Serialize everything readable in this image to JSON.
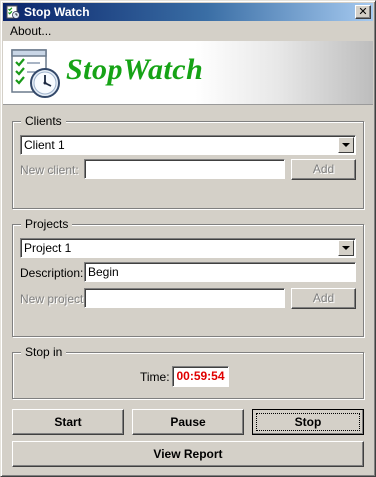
{
  "window": {
    "title": "Stop Watch",
    "close_glyph": "✕"
  },
  "menu": {
    "about": "About..."
  },
  "banner": {
    "brand": "StopWatch",
    "logo_icon": "checklist-clock-icon"
  },
  "clients": {
    "legend": "Clients",
    "selected": "Client 1",
    "new_label": "New client:",
    "new_value": "",
    "add_label": "Add"
  },
  "projects": {
    "legend": "Projects",
    "selected": "Project 1",
    "description_label": "Description:",
    "description_value": "Begin",
    "new_label": "New project:",
    "new_value": "",
    "add_label": "Add"
  },
  "stop_in": {
    "legend": "Stop in",
    "time_label": "Time:",
    "time_value": "00:59:54"
  },
  "actions": {
    "start": "Start",
    "pause": "Pause",
    "stop": "Stop",
    "view_report": "View Report"
  },
  "colors": {
    "brand": "#16a316",
    "time_text": "#e00000",
    "titlebar_start": "#0a246a",
    "titlebar_end": "#a6caf0"
  }
}
